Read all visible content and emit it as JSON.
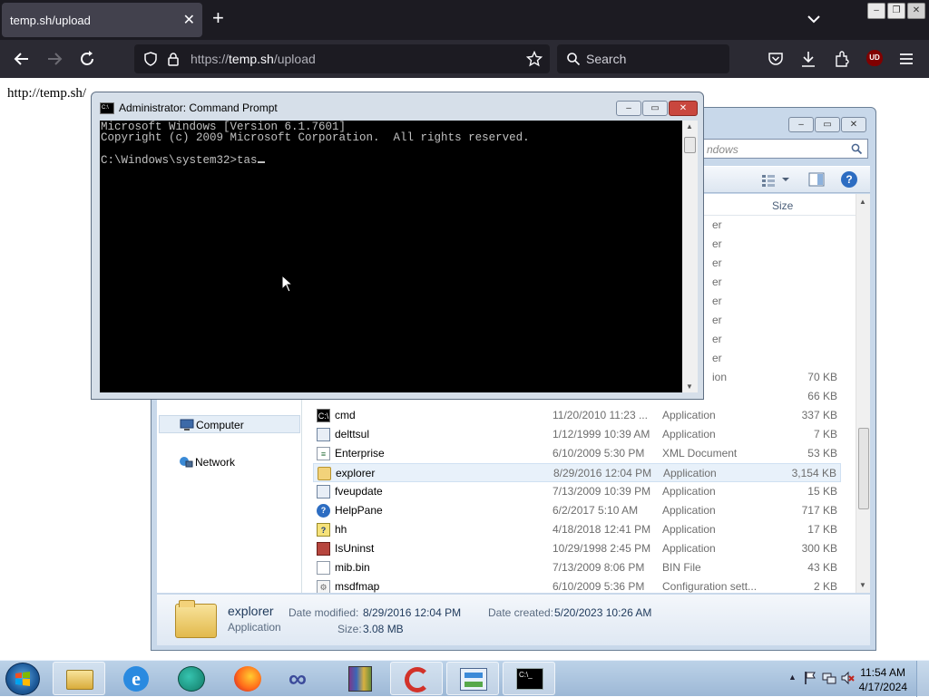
{
  "browser": {
    "tab_title": "temp.sh/upload",
    "url_prefix": "https://",
    "url_host": "temp.sh",
    "url_path": "/upload",
    "search_placeholder": "Search",
    "ublock_label": "UD",
    "page_link": "http://temp.sh/"
  },
  "cmd": {
    "title": "Administrator: Command Prompt",
    "icon_text": "C:\\",
    "lines": [
      "Microsoft Windows [Version 6.1.7601]",
      "Copyright (c) 2009 Microsoft Corporation.  All rights reserved.",
      "",
      "C:\\Windows\\system32>tas"
    ]
  },
  "explorer": {
    "search_placeholder": "ndows",
    "size_header": "Size",
    "nav": [
      {
        "label": "Computer",
        "icon": "computer-icon",
        "selected": true
      },
      {
        "label": "Network",
        "icon": "network-icon",
        "selected": false
      }
    ],
    "partial_rows": [
      {
        "type": "er",
        "size": ""
      },
      {
        "type": "er",
        "size": ""
      },
      {
        "type": "er",
        "size": ""
      },
      {
        "type": "er",
        "size": ""
      },
      {
        "type": "er",
        "size": ""
      },
      {
        "type": "er",
        "size": ""
      },
      {
        "type": "er",
        "size": ""
      },
      {
        "type": "er",
        "size": ""
      },
      {
        "type": "ion",
        "size": "70 KB"
      },
      {
        "type": "",
        "size": "66 KB"
      }
    ],
    "files": [
      {
        "name": "cmd",
        "date": "11/20/2010 11:23 ...",
        "type": "Application",
        "size": "337 KB",
        "icon": "cmd-icon",
        "selected": false
      },
      {
        "name": "delttsul",
        "date": "1/12/1999 10:39 AM",
        "type": "Application",
        "size": "7 KB",
        "icon": "app-icon",
        "selected": false
      },
      {
        "name": "Enterprise",
        "date": "6/10/2009 5:30 PM",
        "type": "XML Document",
        "size": "53 KB",
        "icon": "xml-icon",
        "selected": false
      },
      {
        "name": "explorer",
        "date": "8/29/2016 12:04 PM",
        "type": "Application",
        "size": "3,154 KB",
        "icon": "folder-icon",
        "selected": true
      },
      {
        "name": "fveupdate",
        "date": "7/13/2009 10:39 PM",
        "type": "Application",
        "size": "15 KB",
        "icon": "app-icon",
        "selected": false
      },
      {
        "name": "HelpPane",
        "date": "6/2/2017 5:10 AM",
        "type": "Application",
        "size": "717 KB",
        "icon": "help-icon",
        "selected": false
      },
      {
        "name": "hh",
        "date": "4/18/2018 12:41 PM",
        "type": "Application",
        "size": "17 KB",
        "icon": "chm-icon",
        "selected": false
      },
      {
        "name": "IsUninst",
        "date": "10/29/1998 2:45 PM",
        "type": "Application",
        "size": "300 KB",
        "icon": "uninstall-icon",
        "selected": false
      },
      {
        "name": "mib.bin",
        "date": "7/13/2009 8:06 PM",
        "type": "BIN File",
        "size": "43 KB",
        "icon": "file-icon",
        "selected": false
      },
      {
        "name": "msdfmap",
        "date": "6/10/2009 5:36 PM",
        "type": "Configuration sett...",
        "size": "2 KB",
        "icon": "config-icon",
        "selected": false
      }
    ],
    "details": {
      "name": "explorer",
      "type": "Application",
      "modified_label": "Date modified:",
      "modified_value": "8/29/2016 12:04 PM",
      "created_label": "Date created:",
      "created_value": "5/20/2023 10:26 AM",
      "size_label": "Size:",
      "size_value": "3.08 MB"
    }
  },
  "taskbar": {
    "time": "11:54 AM",
    "date": "4/17/2024",
    "buttons": [
      "explorer",
      "internet-explorer",
      "browser-globe",
      "firefox",
      "infinity-app",
      "winrar",
      "ccleaner",
      "control-panel",
      "command-prompt"
    ]
  },
  "colors": {
    "browser_dark": "#1c1b22",
    "browser_bar": "#2b2a33",
    "console_bg": "#000000",
    "console_fg": "#c0c0c0",
    "aero": "#c8d8ea"
  }
}
